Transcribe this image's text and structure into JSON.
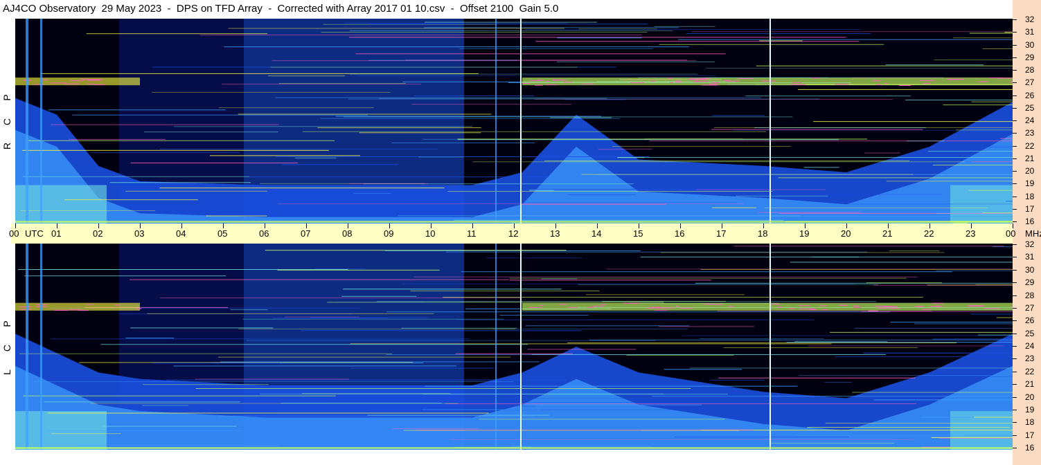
{
  "header": {
    "title": "AJ4CO Observatory  29 May 2023  -  DPS on TFD Array  -  Corrected with Array 2017 01 10.csv  -  Offset 2100  Gain 5.0"
  },
  "panels": {
    "top_label": [
      "R",
      "C",
      "P"
    ],
    "bottom_label": [
      "L",
      "C",
      "P"
    ]
  },
  "time_axis": {
    "labels": [
      "00",
      "UTC",
      "01",
      "02",
      "03",
      "04",
      "05",
      "06",
      "07",
      "08",
      "09",
      "10",
      "11",
      "12",
      "13",
      "14",
      "15",
      "16",
      "17",
      "18",
      "19",
      "20",
      "21",
      "22",
      "23",
      "00",
      "MHz"
    ]
  },
  "freq_axis": {
    "labels": [
      "32",
      "31",
      "30",
      "29",
      "28",
      "27",
      "26",
      "25",
      "24",
      "23",
      "22",
      "21",
      "20",
      "19",
      "18",
      "17",
      "16"
    ]
  },
  "chart_data": [
    {
      "type": "heatmap",
      "name": "RCP spectrogram",
      "x_unit": "UTC hour",
      "y_unit": "MHz",
      "xlim": [
        0,
        24
      ],
      "ylim": [
        16,
        32
      ],
      "palette": [
        "#000010",
        "#0a1a80",
        "#1a4fe0",
        "#3fa0ff",
        "#70e0e0",
        "#c8ff60",
        "#ffff40",
        "#ff60c0"
      ],
      "interference_band_mhz": [
        26.8,
        27.4
      ],
      "markers_utc": [
        12.15,
        18.15
      ],
      "day_noise_edges": [
        {
          "hour": 0,
          "mhz": 25.8
        },
        {
          "hour": 1,
          "mhz": 24.5
        },
        {
          "hour": 2,
          "mhz": 20.5
        },
        {
          "hour": 3,
          "mhz": 19.3
        },
        {
          "hour": 6,
          "mhz": 19.0
        },
        {
          "hour": 11,
          "mhz": 19.0
        },
        {
          "hour": 12.2,
          "mhz": 20.0
        },
        {
          "hour": 13.5,
          "mhz": 24.5
        },
        {
          "hour": 15,
          "mhz": 21.0
        },
        {
          "hour": 18,
          "mhz": 20.5
        },
        {
          "hour": 20,
          "mhz": 20.0
        },
        {
          "hour": 22,
          "mhz": 22.0
        },
        {
          "hour": 24,
          "mhz": 25.5
        }
      ]
    },
    {
      "type": "heatmap",
      "name": "LCP spectrogram",
      "x_unit": "UTC hour",
      "y_unit": "MHz",
      "xlim": [
        0,
        24
      ],
      "ylim": [
        16,
        32
      ],
      "palette": [
        "#000010",
        "#0a1a80",
        "#1a4fe0",
        "#3fa0ff",
        "#70e0e0",
        "#c8ff60",
        "#ffff40",
        "#ff60c0"
      ],
      "interference_band_mhz": [
        26.8,
        27.4
      ],
      "markers_utc": [
        12.15,
        18.15
      ],
      "day_noise_edges": [
        {
          "hour": 0,
          "mhz": 25.0
        },
        {
          "hour": 1,
          "mhz": 23.5
        },
        {
          "hour": 2,
          "mhz": 22.0
        },
        {
          "hour": 3,
          "mhz": 21.5
        },
        {
          "hour": 6,
          "mhz": 21.0
        },
        {
          "hour": 11,
          "mhz": 21.0
        },
        {
          "hour": 12.2,
          "mhz": 22.0
        },
        {
          "hour": 13.5,
          "mhz": 24.0
        },
        {
          "hour": 15,
          "mhz": 22.0
        },
        {
          "hour": 18,
          "mhz": 20.5
        },
        {
          "hour": 20,
          "mhz": 20.0
        },
        {
          "hour": 22,
          "mhz": 22.0
        },
        {
          "hour": 24,
          "mhz": 25.0
        }
      ]
    }
  ]
}
